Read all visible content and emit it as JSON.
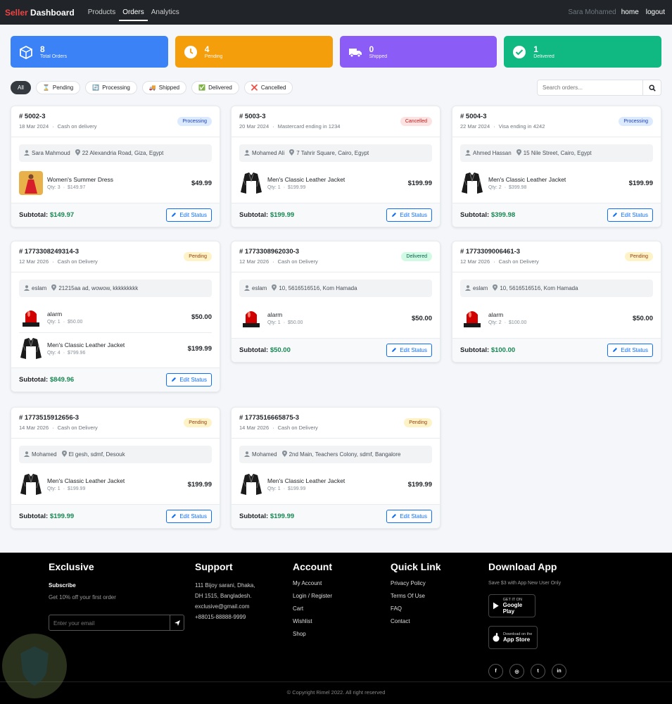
{
  "nav": {
    "brand_red": "Seller",
    "brand_white": "Dashboard",
    "links": [
      "Products",
      "Orders",
      "Analytics"
    ],
    "active": "Orders",
    "user": "Sara Mohamed",
    "home": "home",
    "logout": "logout"
  },
  "stats": [
    {
      "count": "8",
      "label": "Total Orders",
      "color": "#3b82f6",
      "icon": "box-icon"
    },
    {
      "count": "4",
      "label": "Pending",
      "color": "#f59e0b",
      "icon": "clock-icon"
    },
    {
      "count": "0",
      "label": "Shipped",
      "color": "#8b5cf6",
      "icon": "truck-icon"
    },
    {
      "count": "1",
      "label": "Delivered",
      "color": "#10b981",
      "icon": "check-circle-icon"
    }
  ],
  "filters": [
    {
      "label": "All",
      "icon": ""
    },
    {
      "label": "Pending",
      "icon": "⌛"
    },
    {
      "label": "Processing",
      "icon": "🔄"
    },
    {
      "label": "Shipped",
      "icon": "🚚"
    },
    {
      "label": "Delivered",
      "icon": "✅"
    },
    {
      "label": "Cancelled",
      "icon": "❌"
    }
  ],
  "search": {
    "placeholder": "Search orders..."
  },
  "orders": [
    {
      "id": "# 5002-3",
      "date": "18 Mar 2024",
      "payment": "Cash on delivery",
      "status": "Processing",
      "customer": "Sara Mahmoud",
      "address": "22 Alexandria Road, Giza, Egypt",
      "items": [
        {
          "name": "Women's Summer Dress",
          "qty": "Qty: 3",
          "unit": "$149.97",
          "price": "$49.99",
          "thumb": "dress"
        }
      ],
      "subtotal_label": "Subtotal:",
      "subtotal": "$149.97"
    },
    {
      "id": "# 5003-3",
      "date": "20 Mar 2024",
      "payment": "Mastercard ending in 1234",
      "status": "Cancelled",
      "customer": "Mohamed Ali",
      "address": "7 Tahrir Square, Cairo, Egypt",
      "items": [
        {
          "name": "Men's Classic Leather Jacket",
          "qty": "Qty: 1",
          "unit": "$199.99",
          "price": "$199.99",
          "thumb": "jacket"
        }
      ],
      "subtotal_label": "Subtotal:",
      "subtotal": "$199.99"
    },
    {
      "id": "# 5004-3",
      "date": "22 Mar 2024",
      "payment": "Visa ending in 4242",
      "status": "Processing",
      "customer": "Ahmed Hassan",
      "address": "15 Nile Street, Cairo, Egypt",
      "items": [
        {
          "name": "Men's Classic Leather Jacket",
          "qty": "Qty: 2",
          "unit": "$399.98",
          "price": "$199.99",
          "thumb": "jacket"
        }
      ],
      "subtotal_label": "Subtotal:",
      "subtotal": "$399.98"
    },
    {
      "id": "# 1773308249314-3",
      "date": "12 Mar 2026",
      "payment": "Cash on Delivery",
      "status": "Pending",
      "customer": "eslam",
      "address": "21215aa ad, wowow, kkkkkkkkk",
      "items": [
        {
          "name": "alarm",
          "qty": "Qty: 1",
          "unit": "$50.00",
          "price": "$50.00",
          "thumb": "alarm"
        },
        {
          "name": "Men's Classic Leather Jacket",
          "qty": "Qty: 4",
          "unit": "$799.96",
          "price": "$199.99",
          "thumb": "jacket"
        }
      ],
      "subtotal_label": "Subtotal:",
      "subtotal": "$849.96"
    },
    {
      "id": "# 1773308962030-3",
      "date": "12 Mar 2026",
      "payment": "Cash on Delivery",
      "status": "Delivered",
      "customer": "eslam",
      "address": "10, 5616516516, Kom Hamada",
      "items": [
        {
          "name": "alarm",
          "qty": "Qty: 1",
          "unit": "$50.00",
          "price": "$50.00",
          "thumb": "alarm"
        }
      ],
      "subtotal_label": "Subtotal:",
      "subtotal": "$50.00"
    },
    {
      "id": "# 1773309006461-3",
      "date": "12 Mar 2026",
      "payment": "Cash on Delivery",
      "status": "Pending",
      "customer": "eslam",
      "address": "10, 5616516516, Kom Hamada",
      "items": [
        {
          "name": "alarm",
          "qty": "Qty: 2",
          "unit": "$100.00",
          "price": "$50.00",
          "thumb": "alarm"
        }
      ],
      "subtotal_label": "Subtotal:",
      "subtotal": "$100.00"
    },
    {
      "id": "# 1773515912656-3",
      "date": "14 Mar 2026",
      "payment": "Cash on Delivery",
      "status": "Pending",
      "customer": "Mohamed",
      "address": "El gesh, sdmf, Desouk",
      "items": [
        {
          "name": "Men's Classic Leather Jacket",
          "qty": "Qty: 1",
          "unit": "$199.99",
          "price": "$199.99",
          "thumb": "jacket"
        }
      ],
      "subtotal_label": "Subtotal:",
      "subtotal": "$199.99"
    },
    {
      "id": "# 1773516665875-3",
      "date": "14 Mar 2026",
      "payment": "Cash on Delivery",
      "status": "Pending",
      "customer": "Mohamed",
      "address": "2nd Main, Teachers Colony, sdmf, Bangalore",
      "items": [
        {
          "name": "Men's Classic Leather Jacket",
          "qty": "Qty: 1",
          "unit": "$199.99",
          "price": "$199.99",
          "thumb": "jacket"
        }
      ],
      "subtotal_label": "Subtotal:",
      "subtotal": "$199.99"
    }
  ],
  "edit_label": "Edit Status",
  "footer": {
    "exclusive": {
      "title": "Exclusive",
      "subscribe": "Subscribe",
      "offer": "Get 10% off your first order",
      "email_placeholder": "Enter your email"
    },
    "support": {
      "title": "Support",
      "address1": "111 Bijoy sarani, Dhaka,",
      "address2": "DH 1515, Bangladesh.",
      "email": "exclusive@gmail.com",
      "phone": "+88015-88888-9999"
    },
    "account": {
      "title": "Account",
      "links": [
        "My Account",
        "Login / Register",
        "Cart",
        "Wishlist",
        "Shop"
      ]
    },
    "quick": {
      "title": "Quick Link",
      "links": [
        "Privacy Policy",
        "Terms Of Use",
        "FAQ",
        "Contact"
      ]
    },
    "app": {
      "title": "Download App",
      "note": "Save $3 with App New User Only",
      "gp_small": "GET IT ON",
      "gp_big": "Google Play",
      "as_small": "Download on the",
      "as_big": "App Store"
    },
    "social": [
      "f",
      "◎",
      "t",
      "in"
    ],
    "copyright": "© Copyright Rimel 2022. All right reserved"
  }
}
